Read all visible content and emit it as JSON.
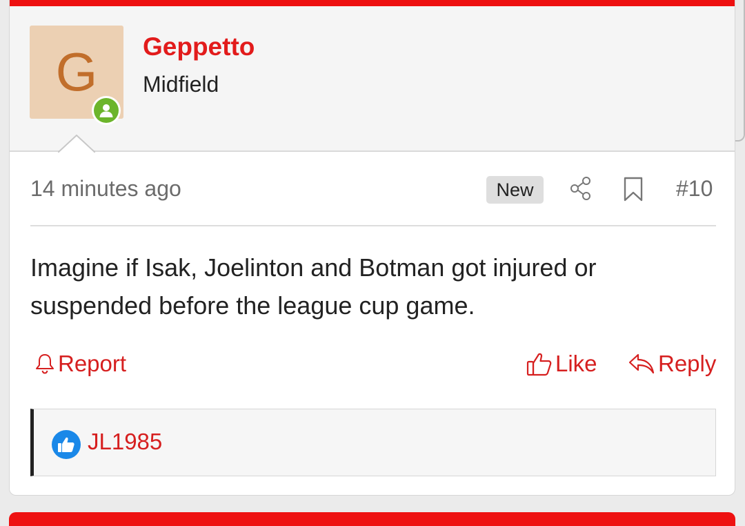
{
  "user": {
    "avatar_letter": "G",
    "name": "Geppetto",
    "title": "Midfield",
    "status_icon": "online-user-icon",
    "colors": {
      "name": "#e21b1b",
      "avatar_bg": "#ecd0b3",
      "avatar_letter": "#c16e2b",
      "online": "#6cb52b"
    }
  },
  "post": {
    "time": "14 minutes ago",
    "badge": "New",
    "number": "#10",
    "message": "Imagine if Isak, Joelinton and Botman got injured or suspended before the league cup game."
  },
  "actions": {
    "report_label": "Report",
    "like_label": "Like",
    "reply_label": "Reply"
  },
  "reactions": {
    "users": [
      "JL1985"
    ],
    "icon": "thumbs-up-icon"
  },
  "theme": {
    "accent": "#ee1111",
    "link": "#d61f1f"
  }
}
